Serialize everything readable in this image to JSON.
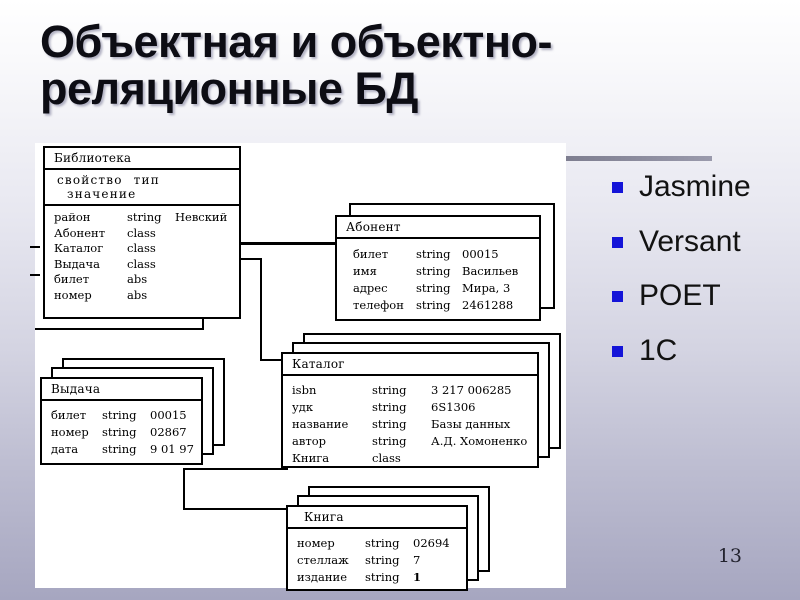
{
  "slide": {
    "title": "Объектная и объектно-реляционные БД",
    "page_number": "13"
  },
  "bullets": {
    "bullet_color": "#1414d8",
    "items": [
      {
        "label": "Jasmine"
      },
      {
        "label": "Versant"
      },
      {
        "label": "POET"
      },
      {
        "label": "1C"
      }
    ]
  },
  "diagram": {
    "column_headers": {
      "property": "свойство",
      "type": "тип",
      "value": "значение"
    },
    "entities": [
      {
        "name": "Библиотека",
        "stack": 0,
        "has_column_header": true,
        "attributes": [
          {
            "property": "район",
            "type": "string",
            "value": "Невский"
          },
          {
            "property": "Абонент",
            "type": "class",
            "value": ""
          },
          {
            "property": "Каталог",
            "type": "class",
            "value": ""
          },
          {
            "property": "Выдача",
            "type": "class",
            "value": ""
          },
          {
            "property": "билет",
            "type": "abs",
            "value": ""
          },
          {
            "property": "номер",
            "type": "abs",
            "value": ""
          }
        ]
      },
      {
        "name": "Абонент",
        "stack": 1,
        "has_column_header": false,
        "attributes": [
          {
            "property": "билет",
            "type": "string",
            "value": "00015"
          },
          {
            "property": "имя",
            "type": "string",
            "value": "Васильев"
          },
          {
            "property": "адрес",
            "type": "string",
            "value": "Мира, 3"
          },
          {
            "property": "телефон",
            "type": "string",
            "value": "2461288"
          }
        ]
      },
      {
        "name": "Каталог",
        "stack": 2,
        "has_column_header": false,
        "attributes": [
          {
            "property": "isbn",
            "type": "string",
            "value": "3 217 006285"
          },
          {
            "property": "удк",
            "type": "string",
            "value": "6S1306"
          },
          {
            "property": "название",
            "type": "string",
            "value": "Базы данных"
          },
          {
            "property": "автор",
            "type": "string",
            "value": "А.Д. Хомоненко"
          },
          {
            "property": "Книга",
            "type": "class",
            "value": ""
          }
        ]
      },
      {
        "name": "Выдача",
        "stack": 2,
        "has_column_header": false,
        "attributes": [
          {
            "property": "билет",
            "type": "string",
            "value": "00015"
          },
          {
            "property": "номер",
            "type": "string",
            "value": "02867"
          },
          {
            "property": "дата",
            "type": "string",
            "value": "9 01 97"
          }
        ]
      },
      {
        "name": "Книга",
        "stack": 2,
        "has_column_header": false,
        "attributes": [
          {
            "property": "номер",
            "type": "string",
            "value": "02694"
          },
          {
            "property": "стеллаж",
            "type": "string",
            "value": "7"
          },
          {
            "property": "издание",
            "type": "string",
            "value": "1"
          }
        ]
      }
    ]
  }
}
